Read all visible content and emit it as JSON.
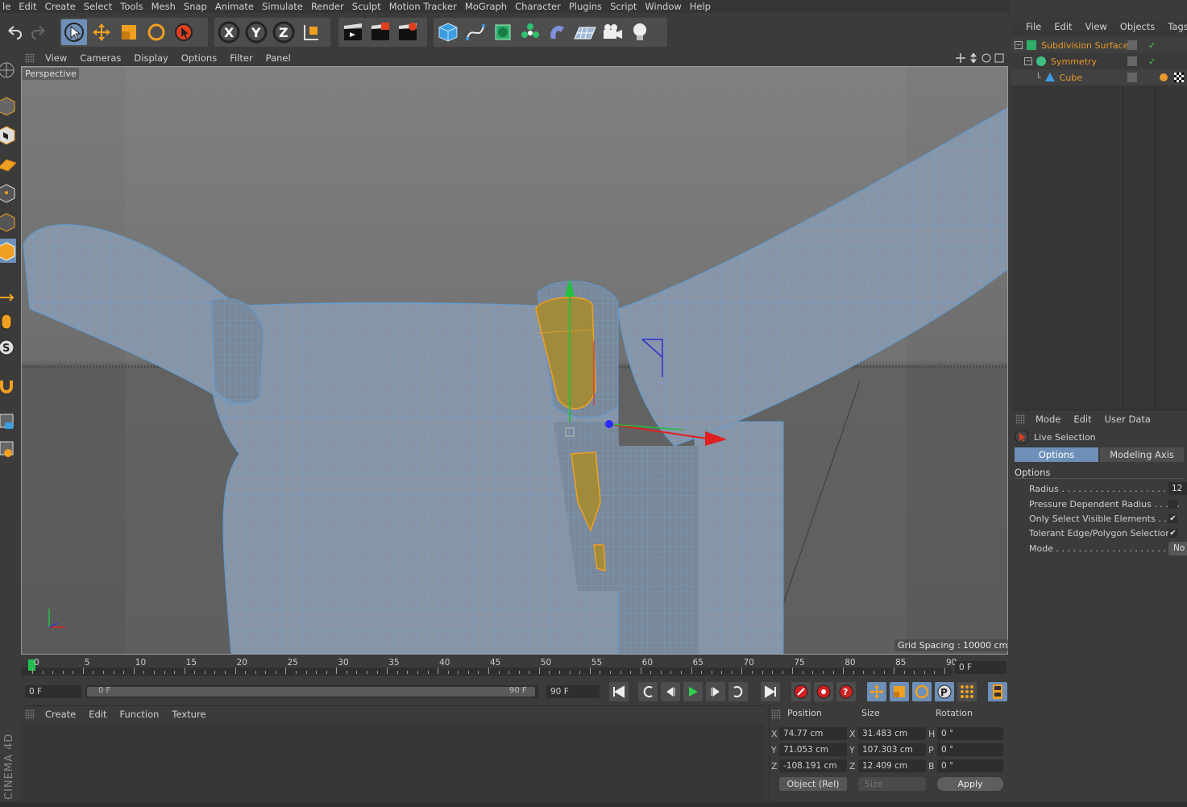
{
  "menubar": [
    "le",
    "Edit",
    "Create",
    "Select",
    "Tools",
    "Mesh",
    "Snap",
    "Animate",
    "Simulate",
    "Render",
    "Sculpt",
    "Motion Tracker",
    "MoGraph",
    "Character",
    "Plugins",
    "Script",
    "Window",
    "Help"
  ],
  "toolbar": {
    "axis_x": "X",
    "axis_y": "Y",
    "axis_z": "Z"
  },
  "viewport": {
    "menu": [
      "View",
      "Cameras",
      "Display",
      "Options",
      "Filter",
      "Panel"
    ],
    "label": "Perspective",
    "grid_spacing": "Grid Spacing : 10000 cm"
  },
  "timeline": {
    "ticks": [
      "0",
      "5",
      "10",
      "15",
      "20",
      "25",
      "30",
      "35",
      "40",
      "45",
      "50",
      "55",
      "60",
      "65",
      "70",
      "75",
      "80",
      "85",
      "90"
    ],
    "current_frame": "0 F",
    "start_frame": "0 F",
    "range_start": "0 F",
    "range_end": "90 F",
    "end_frame": "90 F"
  },
  "material_panel": {
    "menu": [
      "Create",
      "Edit",
      "Function",
      "Texture"
    ]
  },
  "coord_panel": {
    "headers": {
      "position": "Position",
      "size": "Size",
      "rotation": "Rotation"
    },
    "pos": {
      "x": "74.77 cm",
      "y": "71.053 cm",
      "z": "-108.191 cm"
    },
    "size": {
      "x": "31.483 cm",
      "y": "107.303 cm",
      "z": "12.409 cm"
    },
    "rot": {
      "h": "0 °",
      "p": "0 °",
      "b": "0 °"
    },
    "axis_labels": {
      "x": "X",
      "y": "Y",
      "z": "Z",
      "h": "H",
      "p": "P",
      "b": "B"
    },
    "mode_select": "Object (Rel)",
    "size_select": "Size",
    "apply": "Apply"
  },
  "object_manager": {
    "menu": [
      "File",
      "Edit",
      "View",
      "Objects",
      "Tags"
    ],
    "objects": [
      {
        "name": "Subdivision Surface",
        "color": "#e79a2c"
      },
      {
        "name": "Symmetry",
        "color": "#e79a2c"
      },
      {
        "name": "Cube",
        "color": "#e79a2c"
      }
    ]
  },
  "attributes": {
    "menu": [
      "Mode",
      "Edit",
      "User Data"
    ],
    "tool_name": "Live Selection",
    "tabs": [
      "Options",
      "Modeling Axis"
    ],
    "section": "Options",
    "rows": [
      {
        "label": "Radius . . . . . . . . . . . . . . . . . . . . .",
        "value": "12"
      },
      {
        "label": "Pressure Dependent Radius . . . . .",
        "value": ""
      },
      {
        "label": "Only Select Visible Elements . . . .",
        "value": "✔"
      },
      {
        "label": "Tolerant Edge/Polygon Selection",
        "value": "✔"
      },
      {
        "label": "Mode . . . . . . . . . . . . . . . . . . . . . . .",
        "value": "No"
      }
    ]
  },
  "brand": "CINEMA 4D",
  "colors": {
    "accent": "#6d8fb8",
    "object_orange": "#e79a2c",
    "bg": "#3b3b3b"
  }
}
